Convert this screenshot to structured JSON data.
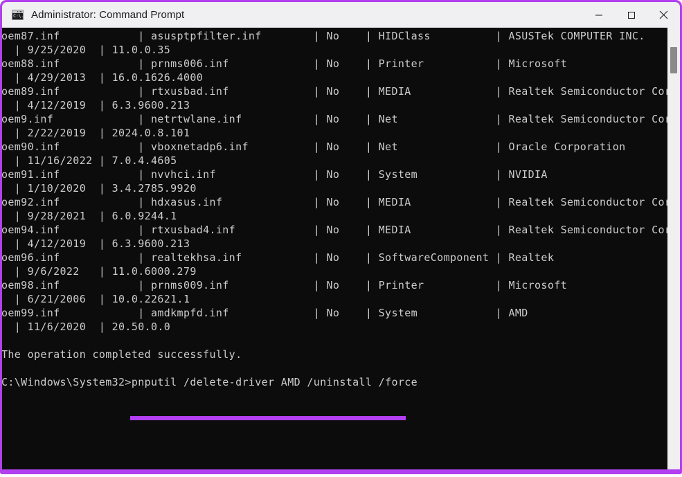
{
  "window": {
    "title": "Administrator: Command Prompt",
    "icon": "command-prompt-icon",
    "icon_text": "C:\\.",
    "accent_color": "#b23ff0",
    "titlebar_color": "#f0eff1",
    "terminal_background": "#0c0c0c",
    "terminal_foreground": "#cccccc",
    "controls": {
      "minimize_label": "Minimize",
      "maximize_label": "Maximize",
      "close_label": "Close"
    }
  },
  "scrollbar": {
    "thumb_label": "vertical-scroll-thumb",
    "track_label": "vertical-scroll-track"
  },
  "terminal": {
    "drivers": [
      {
        "published_name": "oem87.inf",
        "original_name": "asusptpfilter.inf",
        "boot_critical": "No",
        "class_name": "HIDClass",
        "provider_name": "ASUSTek COMPUTER INC.",
        "driver_date": "9/25/2020",
        "driver_version": "11.0.0.35"
      },
      {
        "published_name": "oem88.inf",
        "original_name": "prnms006.inf",
        "boot_critical": "No",
        "class_name": "Printer",
        "provider_name": "Microsoft",
        "driver_date": "4/29/2013",
        "driver_version": "16.0.1626.4000"
      },
      {
        "published_name": "oem89.inf",
        "original_name": "rtxusbad.inf",
        "boot_critical": "No",
        "class_name": "MEDIA",
        "provider_name": "Realtek Semiconductor Corp.",
        "driver_date": "4/12/2019",
        "driver_version": "6.3.9600.213"
      },
      {
        "published_name": "oem9.inf",
        "original_name": "netrtwlane.inf",
        "boot_critical": "No",
        "class_name": "Net",
        "provider_name": "Realtek Semiconductor Corp.",
        "driver_date": "2/22/2019",
        "driver_version": "2024.0.8.101"
      },
      {
        "published_name": "oem90.inf",
        "original_name": "vboxnetadp6.inf",
        "boot_critical": "No",
        "class_name": "Net",
        "provider_name": "Oracle Corporation",
        "driver_date": "11/16/2022",
        "driver_version": "7.0.4.4605"
      },
      {
        "published_name": "oem91.inf",
        "original_name": "nvvhci.inf",
        "boot_critical": "No",
        "class_name": "System",
        "provider_name": "NVIDIA",
        "driver_date": "1/10/2020",
        "driver_version": "3.4.2785.9920"
      },
      {
        "published_name": "oem92.inf",
        "original_name": "hdxasus.inf",
        "boot_critical": "No",
        "class_name": "MEDIA",
        "provider_name": "Realtek Semiconductor Corp.",
        "driver_date": "9/28/2021",
        "driver_version": "6.0.9244.1"
      },
      {
        "published_name": "oem94.inf",
        "original_name": "rtxusbad4.inf",
        "boot_critical": "No",
        "class_name": "MEDIA",
        "provider_name": "Realtek Semiconductor Corp.",
        "driver_date": "4/12/2019",
        "driver_version": "6.3.9600.213"
      },
      {
        "published_name": "oem96.inf",
        "original_name": "realtekhsa.inf",
        "boot_critical": "No",
        "class_name": "SoftwareComponent",
        "provider_name": "Realtek",
        "driver_date": "9/6/2022",
        "driver_version": "11.0.6000.279"
      },
      {
        "published_name": "oem98.inf",
        "original_name": "prnms009.inf",
        "boot_critical": "No",
        "class_name": "Printer",
        "provider_name": "Microsoft",
        "driver_date": "6/21/2006",
        "driver_version": "10.0.22621.1"
      },
      {
        "published_name": "oem99.inf",
        "original_name": "amdkmpfd.inf",
        "boot_critical": "No",
        "class_name": "System",
        "provider_name": "AMD",
        "driver_date": "11/6/2020",
        "driver_version": "20.50.0.0"
      }
    ],
    "status_message": "The operation completed successfully.",
    "prompt_path": "C:\\Windows\\System32>",
    "command": "pnputil /delete-driver AMD /uninstall /force",
    "body": "oem87.inf            | asusptpfilter.inf        | No    | HIDClass          | ASUSTek COMPUTER INC.\n  | 9/25/2020  | 11.0.0.35\noem88.inf            | prnms006.inf             | No    | Printer           | Microsoft\n  | 4/29/2013  | 16.0.1626.4000\noem89.inf            | rtxusbad.inf             | No    | MEDIA             | Realtek Semiconductor Corp.\n  | 4/12/2019  | 6.3.9600.213\noem9.inf             | netrtwlane.inf           | No    | Net               | Realtek Semiconductor Corp.\n  | 2/22/2019  | 2024.0.8.101\noem90.inf            | vboxnetadp6.inf          | No    | Net               | Oracle Corporation\n  | 11/16/2022 | 7.0.4.4605\noem91.inf            | nvvhci.inf               | No    | System            | NVIDIA\n  | 1/10/2020  | 3.4.2785.9920\noem92.inf            | hdxasus.inf              | No    | MEDIA             | Realtek Semiconductor Corp.\n  | 9/28/2021  | 6.0.9244.1\noem94.inf            | rtxusbad4.inf            | No    | MEDIA             | Realtek Semiconductor Corp.\n  | 4/12/2019  | 6.3.9600.213\noem96.inf            | realtekhsa.inf           | No    | SoftwareComponent | Realtek\n  | 9/6/2022   | 11.0.6000.279\noem98.inf            | prnms009.inf             | No    | Printer           | Microsoft\n  | 6/21/2006  | 10.0.22621.1\noem99.inf            | amdkmpfd.inf             | No    | System            | AMD\n  | 11/6/2020  | 20.50.0.0\n\nThe operation completed successfully.\n\nC:\\Windows\\System32>pnputil /delete-driver AMD /uninstall /force"
  }
}
